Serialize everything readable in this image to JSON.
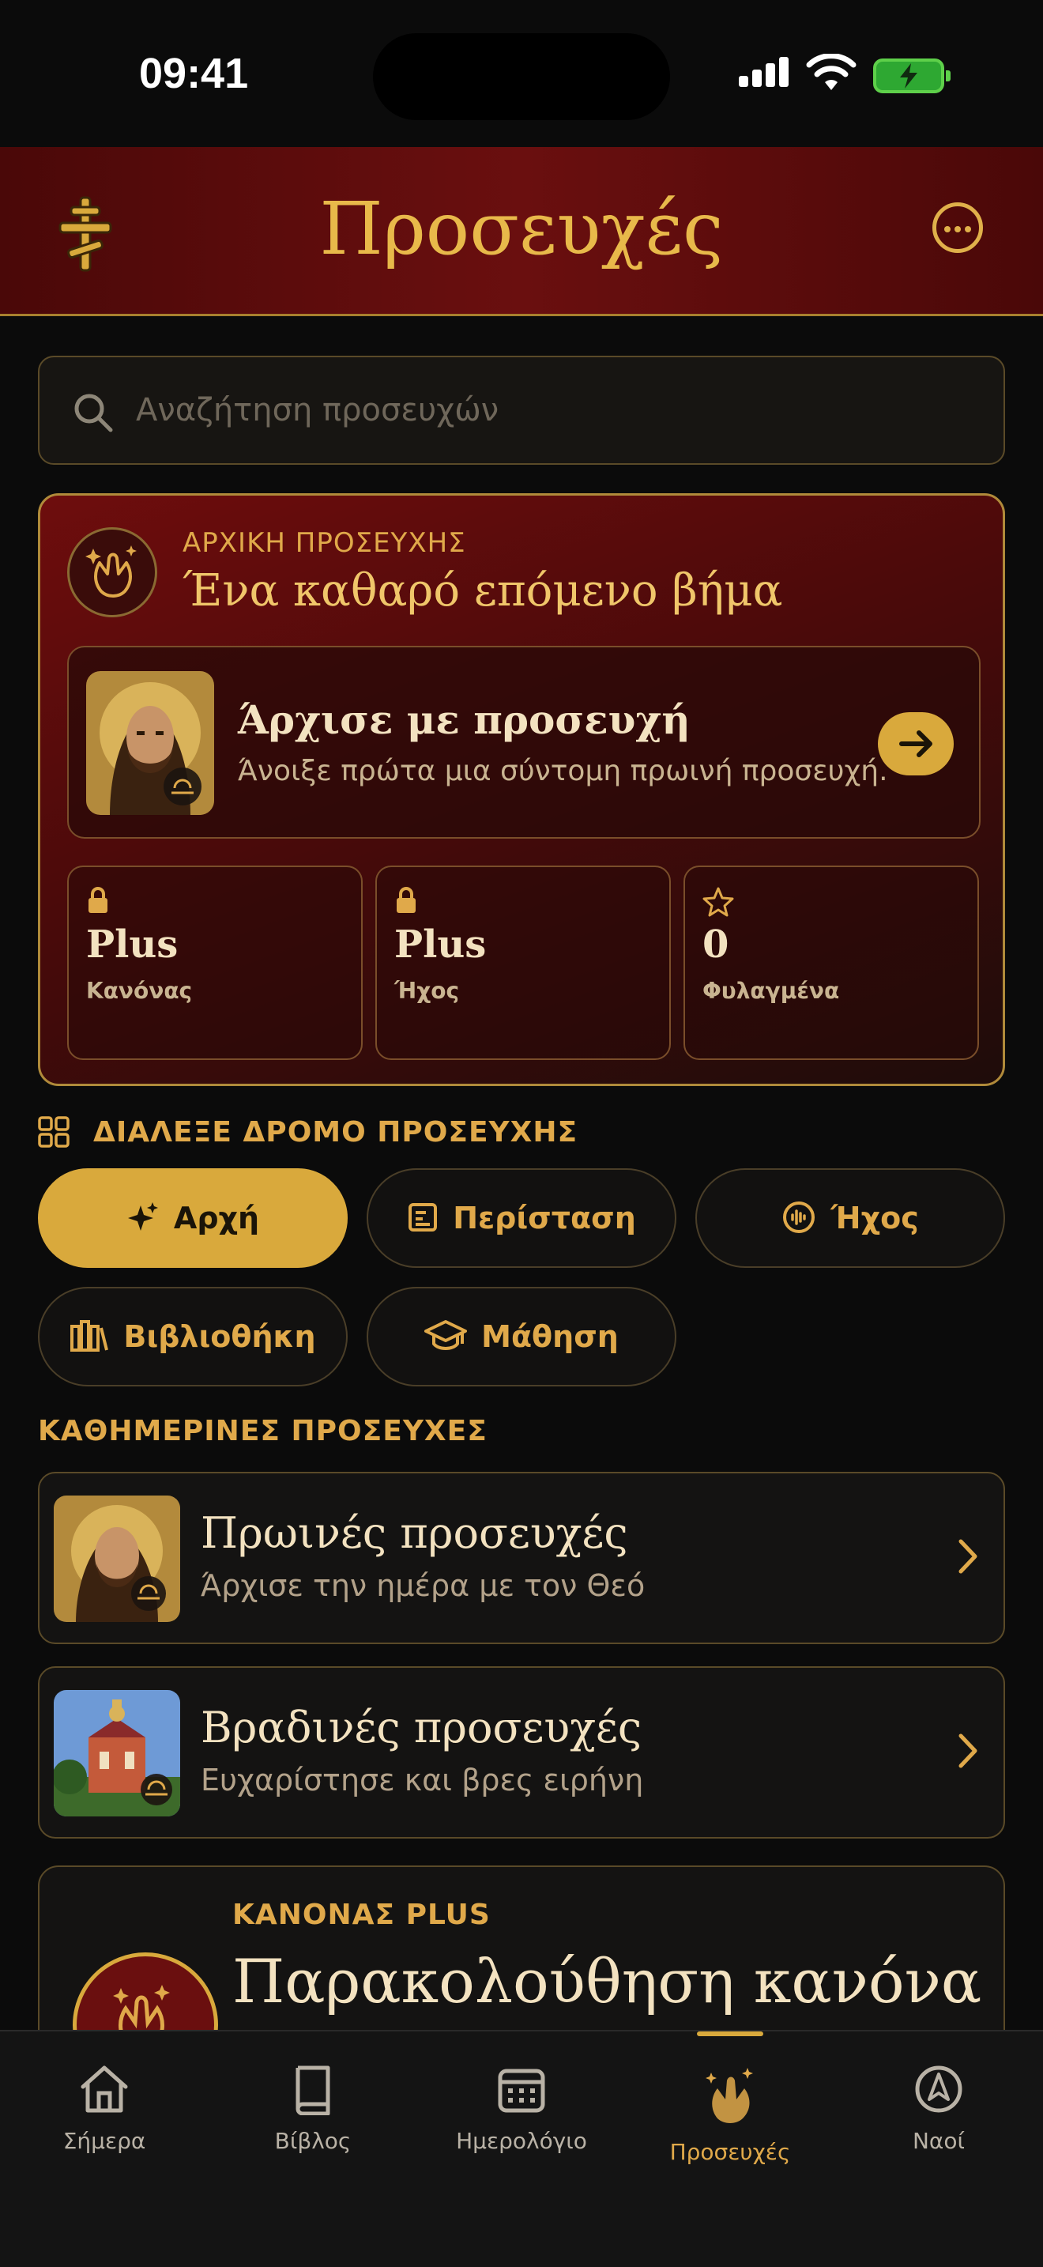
{
  "status": {
    "time": "09:41"
  },
  "header": {
    "title": "Προσευχές"
  },
  "search": {
    "placeholder": "Αναζήτηση προσευχών"
  },
  "hero": {
    "kicker": "ΑΡΧΙΚΗ ΠΡΟΣΕΥΧΗΣ",
    "headline": "Ένα καθαρό επόμενο βήμα",
    "start": {
      "title": "Άρχισε με προσευχή",
      "subtitle": "Άνοιξε πρώτα μια σύντομη πρωινή προσευχή."
    },
    "stats": [
      {
        "value": "Plus",
        "label": "Κανόνας",
        "icon": "lock-icon"
      },
      {
        "value": "Plus",
        "label": "Ήχος",
        "icon": "lock-icon"
      },
      {
        "value": "0",
        "label": "Φυλαγμένα",
        "icon": "star-icon"
      }
    ]
  },
  "paths": {
    "heading": "ΔΙΑΛΕΞΕ ΔΡΟΜΟ ΠΡΟΣΕΥΧΗΣ",
    "chips": [
      {
        "label": "Αρχή",
        "icon": "sparkle-icon",
        "active": true
      },
      {
        "label": "Περίσταση",
        "icon": "note-icon",
        "active": false
      },
      {
        "label": "Ήχος",
        "icon": "audio-icon",
        "active": false
      },
      {
        "label": "Βιβλιοθήκη",
        "icon": "library-icon",
        "active": false
      },
      {
        "label": "Μάθηση",
        "icon": "graduation-cap-icon",
        "active": false
      }
    ]
  },
  "daily": {
    "heading": "ΚΑΘΗΜΕΡΙΝΕΣ ΠΡΟΣΕΥΧΕΣ",
    "items": [
      {
        "title": "Πρωινές προσευχές",
        "subtitle": "Άρχισε την ημέρα με τον Θεό"
      },
      {
        "title": "Βραδινές προσευχές",
        "subtitle": "Ευχαρίστησε και βρες ειρήνη"
      }
    ]
  },
  "kanon": {
    "kicker": "ΚΑΝΟΝΑΣ PLUS",
    "title": "Παρακολούθηση κανόνα"
  },
  "tabs": [
    {
      "label": "Σήμερα",
      "icon": "home-icon"
    },
    {
      "label": "Βίβλος",
      "icon": "book-icon"
    },
    {
      "label": "Ημερολόγιο",
      "icon": "calendar-icon"
    },
    {
      "label": "Προσευχές",
      "icon": "praying-hands-icon",
      "active": true
    },
    {
      "label": "Ναοί",
      "icon": "compass-icon"
    }
  ],
  "colors": {
    "accent": "#d9a93c",
    "header": "#6a0f0f",
    "background": "#0b0b0b"
  }
}
